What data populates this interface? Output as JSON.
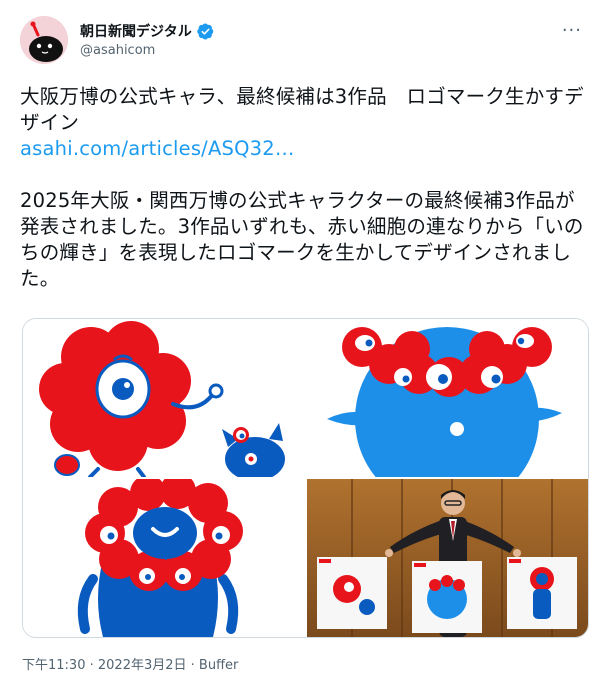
{
  "account": {
    "display_name": "朝日新聞デジタル",
    "handle": "@asahicom",
    "verified": true
  },
  "menu": {
    "more_label": "···"
  },
  "tweet": {
    "line1": "大阪万博の公式キャラ、最終候補は3作品　ロゴマーク生かすデザイン",
    "link": "asahi.com/articles/ASQ32…",
    "line2": "2025年大阪・関西万博の公式キャラクターの最終候補3作品が発表されました。3作品いずれも、赤い細胞の連なりから「いのちの輝き」を表現したロゴマークを生かしてデザインされました。"
  },
  "meta": {
    "time": "下午11:30",
    "date": "2022年3月2日",
    "source": "Buffer",
    "separator": " · "
  },
  "colors": {
    "link": "#1d9bf0",
    "verified": "#1d9bf0",
    "character_red": "#e8141c",
    "character_blue": "#0a5bbf",
    "character_sky": "#1e8fe8"
  }
}
